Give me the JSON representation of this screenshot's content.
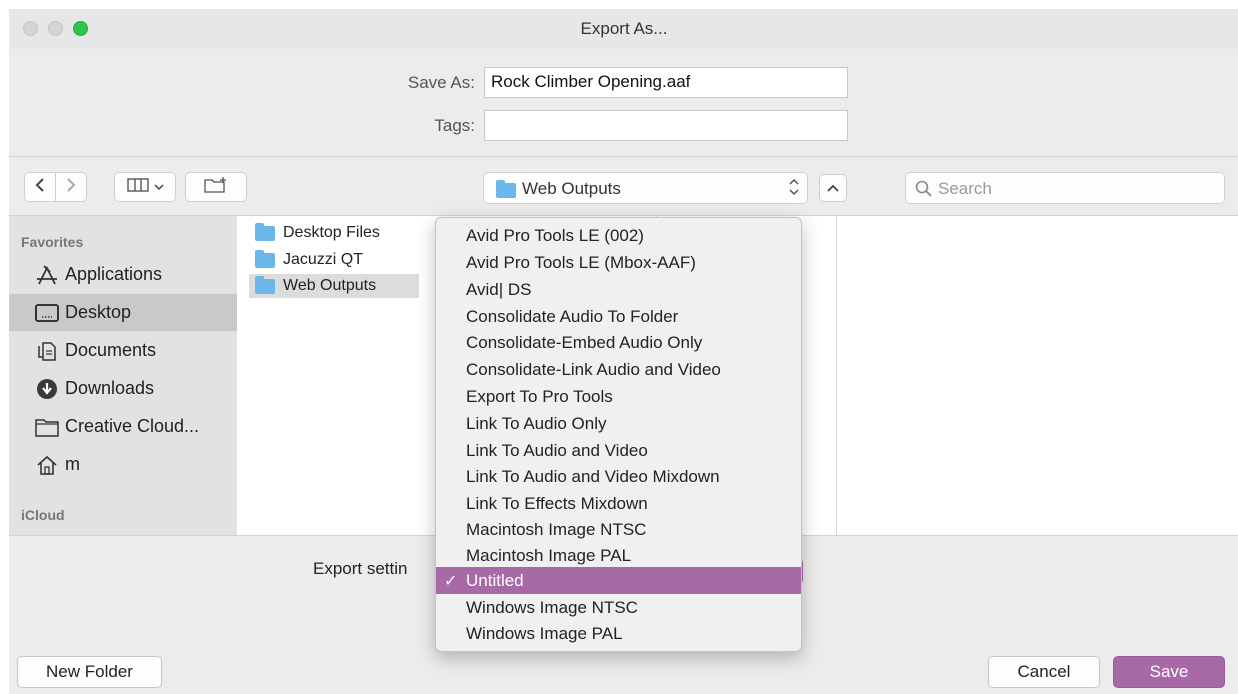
{
  "window": {
    "title": "Export As...",
    "accent_color": "#a86aa6"
  },
  "save_as": {
    "label": "Save As:",
    "value": "Rock Climber Opening.aaf"
  },
  "tags": {
    "label": "Tags:",
    "value": ""
  },
  "toolbar": {
    "back_icon": "chevron-left-icon",
    "forward_icon": "chevron-right-icon",
    "view_icon": "column-view-icon",
    "new_folder_icon": "new-folder-icon",
    "location": "Web Outputs",
    "search_placeholder": "Search"
  },
  "sidebar": {
    "favorites_header": "Favorites",
    "items": [
      {
        "label": "Applications",
        "icon": "applications-icon"
      },
      {
        "label": "Desktop",
        "icon": "desktop-icon"
      },
      {
        "label": "Documents",
        "icon": "documents-icon"
      },
      {
        "label": "Downloads",
        "icon": "downloads-icon"
      },
      {
        "label": "Creative Cloud...",
        "icon": "folder-icon"
      },
      {
        "label": "m",
        "icon": "home-icon"
      }
    ],
    "icloud_header": "iCloud"
  },
  "files": [
    {
      "name": "Desktop Files"
    },
    {
      "name": "Jacuzzi QT"
    },
    {
      "name": "Web Outputs"
    }
  ],
  "export_settings": {
    "label": "Export settin",
    "selected": "Untitled",
    "options": [
      "Avid Pro Tools LE (002)",
      "Avid Pro Tools LE (Mbox-AAF)",
      "Avid| DS",
      "Consolidate Audio To Folder",
      "Consolidate-Embed Audio Only",
      "Consolidate-Link Audio and Video",
      "Export To Pro Tools",
      "Link To Audio Only",
      "Link To Audio and Video",
      "Link To Audio and Video Mixdown",
      "Link To Effects Mixdown",
      "Macintosh Image NTSC",
      "Macintosh Image PAL",
      "Untitled",
      "Windows Image NTSC",
      "Windows Image PAL"
    ]
  },
  "buttons": {
    "new_folder": "New Folder",
    "cancel": "Cancel",
    "save": "Save"
  }
}
